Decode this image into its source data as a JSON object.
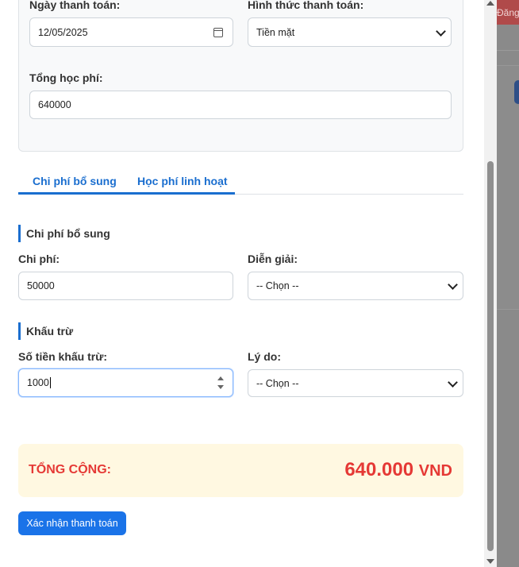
{
  "background": {
    "header_button": "Đăng"
  },
  "payment": {
    "date_label": "Ngày thanh toán:",
    "date_value": "12/05/2025",
    "method_label": "Hình thức thanh toán:",
    "method_value": "Tiền mặt",
    "total_fee_label": "Tổng học phí:",
    "total_fee_value": "640000"
  },
  "tabs": [
    {
      "label": "Chi phí bổ sung",
      "active": true
    },
    {
      "label": "Học phí linh hoạt",
      "active": false
    }
  ],
  "additional_cost": {
    "section_title": "Chi phí bổ sung",
    "cost_label": "Chi phí:",
    "cost_value": "50000",
    "description_label": "Diễn giải:",
    "description_value": "-- Chọn --"
  },
  "deduction": {
    "section_title": "Khấu trừ",
    "amount_label": "Số tiền khấu trừ:",
    "amount_value": "1000",
    "reason_label": "Lý do:",
    "reason_value": "-- Chọn --"
  },
  "summary": {
    "total_label": "TỔNG CỘNG:",
    "total_amount": "640.000",
    "currency": "VND"
  },
  "confirm_button": "Xác nhận thanh toán",
  "colors": {
    "accent": "#1a6ecf",
    "total": "#e53935",
    "total_bg": "#fff8e1"
  }
}
